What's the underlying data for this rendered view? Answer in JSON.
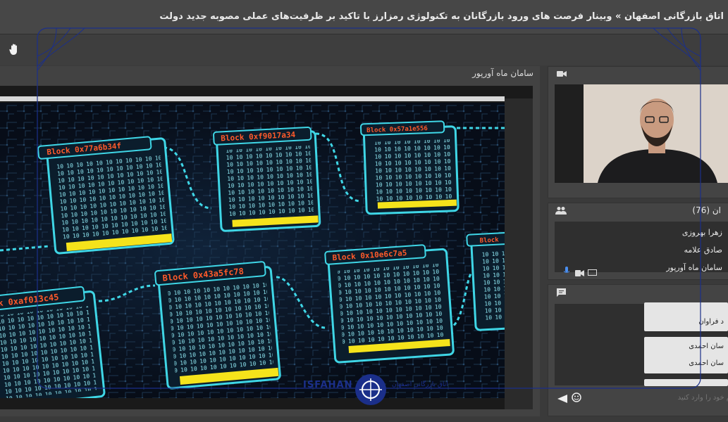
{
  "header": {
    "title": "اتاق بازرگانی اصفهان » وبینار فرصت های ورود بازرگانان به تکنولوژی رمزارز با تاکید بر ظرفیت‌های عملی مصوبه جدید دولت"
  },
  "toolbar": {
    "raise_hand_icon": "hand-icon"
  },
  "presentation": {
    "title": "سامان ماه آورپور",
    "blocks": [
      {
        "label": "Block 0x77a6b34f"
      },
      {
        "label": "Block 0xf9017a34"
      },
      {
        "label": "Block 0x57a1e556"
      },
      {
        "label": "ck 0xaf013c45"
      },
      {
        "label": "Block 0x43a5fc78"
      },
      {
        "label": "Block 0x10e6c7a5"
      },
      {
        "label": "Block"
      }
    ]
  },
  "video": {
    "camera_icon": "video-camera-icon"
  },
  "users": {
    "header": "ان (76)",
    "items": [
      {
        "name": "زهرا بهروزی"
      },
      {
        "name": "صادق علامه"
      },
      {
        "name": "سامان ماه آورپور"
      }
    ]
  },
  "chat": {
    "messages": [
      {
        "text": "د فراوان"
      },
      {
        "text": "سان احمدی"
      },
      {
        "text": "سان احمدی"
      }
    ],
    "input_placeholder": "م خود را وارد کنید"
  },
  "watermark": {
    "brand_en": "ISFAHAN",
    "brand_fa": "اتاق بازرگانی اصفهان"
  },
  "colors": {
    "cyan": "#3fd6e6",
    "block_label": "#ff5a2a",
    "block_bar": "#f5e31b",
    "frame_blue": "#1b2f8a"
  }
}
